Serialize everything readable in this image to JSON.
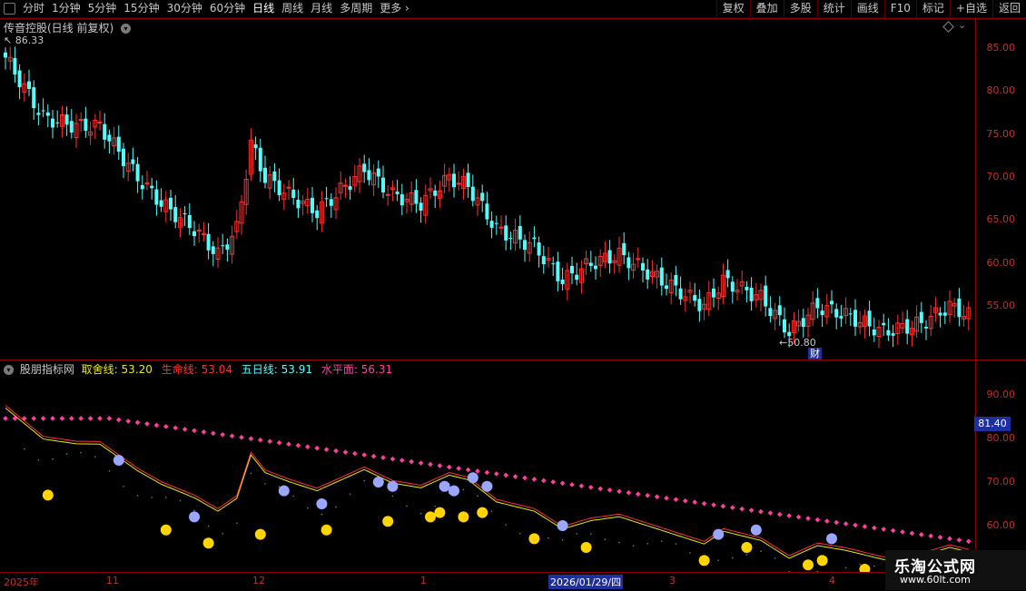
{
  "toolbar": {
    "periods": [
      "分时",
      "1分钟",
      "5分钟",
      "15分钟",
      "30分钟",
      "60分钟",
      "日线",
      "周线",
      "月线",
      "多周期",
      "更多"
    ],
    "active_index": 6,
    "more_chevron": "›",
    "buttons": [
      "复权",
      "叠加",
      "多股",
      "统计",
      "画线",
      "F10",
      "标记",
      "+自选",
      "返回"
    ]
  },
  "main_chart": {
    "stock_title": "传音控股(日线 前复权)",
    "high_label": "86.33",
    "low_label": "50.80",
    "fin_badge": "财",
    "y_axis": [
      "85.00",
      "80.00",
      "75.00",
      "70.00",
      "65.00",
      "60.00",
      "55.00"
    ],
    "colors": {
      "up": "#ff3030",
      "down": "#54fcfc"
    }
  },
  "indicator": {
    "name": "股朋指标网",
    "lines": [
      {
        "label": "取舍线:",
        "value": "53.20",
        "color": "#e8e800"
      },
      {
        "label": "生命线:",
        "value": "53.04",
        "color": "#ff3030"
      },
      {
        "label": "五日线:",
        "value": "53.91",
        "color": "#54fcfc"
      },
      {
        "label": "水平面:",
        "value": "56.31",
        "color": "#ff3fa0"
      }
    ],
    "y_axis": [
      "90.00",
      "80.00",
      "70.00",
      "60.00"
    ],
    "current_value": "81.40"
  },
  "date_axis": {
    "labels": [
      "2025年",
      "11",
      "12",
      "1",
      "2026/01/29/四",
      "3",
      "4"
    ]
  },
  "watermark": {
    "name": "乐淘公式网",
    "url": "www.60lt.com"
  }
}
